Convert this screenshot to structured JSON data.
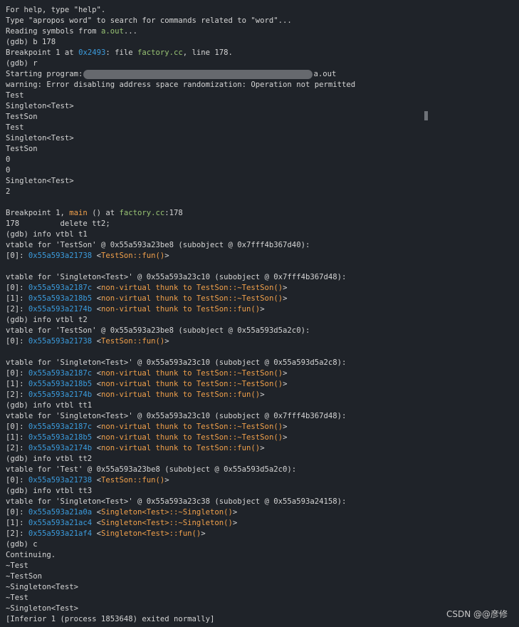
{
  "terminal": {
    "lines": [
      [
        {
          "t": "For help, type \"help\".",
          "s": "plain"
        }
      ],
      [
        {
          "t": "Type \"apropos word\" to search for commands related to \"word\"...",
          "s": "plain"
        }
      ],
      [
        {
          "t": "Reading symbols from ",
          "s": "plain"
        },
        {
          "t": "a.out",
          "s": "file"
        },
        {
          "t": "...",
          "s": "plain"
        }
      ],
      [
        {
          "t": "(gdb) b 178",
          "s": "plain"
        }
      ],
      [
        {
          "t": "Breakpoint 1 at ",
          "s": "plain"
        },
        {
          "t": "0x2493",
          "s": "addr"
        },
        {
          "t": ": file ",
          "s": "plain"
        },
        {
          "t": "factory.cc",
          "s": "file"
        },
        {
          "t": ", line 178.",
          "s": "plain"
        }
      ],
      [
        {
          "t": "(gdb) r",
          "s": "plain"
        }
      ],
      [
        {
          "t": "Starting program:",
          "s": "plain"
        },
        {
          "t": "",
          "s": "redacted"
        },
        {
          "t": "a.out",
          "s": "plain"
        }
      ],
      [
        {
          "t": "warning: Error disabling address space randomization: Operation not permitted",
          "s": "plain"
        }
      ],
      [
        {
          "t": "Test",
          "s": "plain"
        }
      ],
      [
        {
          "t": "Singleton<Test>",
          "s": "plain"
        }
      ],
      [
        {
          "t": "TestSon",
          "s": "plain"
        }
      ],
      [
        {
          "t": "Test",
          "s": "plain"
        }
      ],
      [
        {
          "t": "Singleton<Test>",
          "s": "plain"
        }
      ],
      [
        {
          "t": "TestSon",
          "s": "plain"
        }
      ],
      [
        {
          "t": "0",
          "s": "plain"
        }
      ],
      [
        {
          "t": "0",
          "s": "plain"
        }
      ],
      [
        {
          "t": "Singleton<Test>",
          "s": "plain"
        }
      ],
      [
        {
          "t": "2",
          "s": "plain"
        }
      ],
      [],
      [
        {
          "t": "Breakpoint 1, ",
          "s": "plain"
        },
        {
          "t": "main",
          "s": "func"
        },
        {
          "t": " () at ",
          "s": "plain"
        },
        {
          "t": "factory.cc",
          "s": "file"
        },
        {
          "t": ":178",
          "s": "plain"
        }
      ],
      [
        {
          "t": "178         delete tt2;",
          "s": "plain"
        }
      ],
      [
        {
          "t": "(gdb) info vtbl t1",
          "s": "plain"
        }
      ],
      [
        {
          "t": "vtable for 'TestSon' @ 0x55a593a23be8 (subobject @ 0x7fff4b367d40):",
          "s": "plain"
        }
      ],
      [
        {
          "t": "[0]: ",
          "s": "plain"
        },
        {
          "t": "0x55a593a21738",
          "s": "addr"
        },
        {
          "t": " <",
          "s": "plain"
        },
        {
          "t": "TestSon::fun()",
          "s": "func"
        },
        {
          "t": ">",
          "s": "plain"
        }
      ],
      [],
      [
        {
          "t": "vtable for 'Singleton<Test>' @ 0x55a593a23c10 (subobject @ 0x7fff4b367d48):",
          "s": "plain"
        }
      ],
      [
        {
          "t": "[0]: ",
          "s": "plain"
        },
        {
          "t": "0x55a593a2187c",
          "s": "addr"
        },
        {
          "t": " <",
          "s": "plain"
        },
        {
          "t": "non-virtual thunk to TestSon::~TestSon()",
          "s": "func"
        },
        {
          "t": ">",
          "s": "plain"
        }
      ],
      [
        {
          "t": "[1]: ",
          "s": "plain"
        },
        {
          "t": "0x55a593a218b5",
          "s": "addr"
        },
        {
          "t": " <",
          "s": "plain"
        },
        {
          "t": "non-virtual thunk to TestSon::~TestSon()",
          "s": "func"
        },
        {
          "t": ">",
          "s": "plain"
        }
      ],
      [
        {
          "t": "[2]: ",
          "s": "plain"
        },
        {
          "t": "0x55a593a2174b",
          "s": "addr"
        },
        {
          "t": " <",
          "s": "plain"
        },
        {
          "t": "non-virtual thunk to TestSon::fun()",
          "s": "func"
        },
        {
          "t": ">",
          "s": "plain"
        }
      ],
      [
        {
          "t": "(gdb) info vtbl t2",
          "s": "plain"
        }
      ],
      [
        {
          "t": "vtable for 'TestSon' @ 0x55a593a23be8 (subobject @ 0x55a593d5a2c0):",
          "s": "plain"
        }
      ],
      [
        {
          "t": "[0]: ",
          "s": "plain"
        },
        {
          "t": "0x55a593a21738",
          "s": "addr"
        },
        {
          "t": " <",
          "s": "plain"
        },
        {
          "t": "TestSon::fun()",
          "s": "func"
        },
        {
          "t": ">",
          "s": "plain"
        }
      ],
      [],
      [
        {
          "t": "vtable for 'Singleton<Test>' @ 0x55a593a23c10 (subobject @ 0x55a593d5a2c8):",
          "s": "plain"
        }
      ],
      [
        {
          "t": "[0]: ",
          "s": "plain"
        },
        {
          "t": "0x55a593a2187c",
          "s": "addr"
        },
        {
          "t": " <",
          "s": "plain"
        },
        {
          "t": "non-virtual thunk to TestSon::~TestSon()",
          "s": "func"
        },
        {
          "t": ">",
          "s": "plain"
        }
      ],
      [
        {
          "t": "[1]: ",
          "s": "plain"
        },
        {
          "t": "0x55a593a218b5",
          "s": "addr"
        },
        {
          "t": " <",
          "s": "plain"
        },
        {
          "t": "non-virtual thunk to TestSon::~TestSon()",
          "s": "func"
        },
        {
          "t": ">",
          "s": "plain"
        }
      ],
      [
        {
          "t": "[2]: ",
          "s": "plain"
        },
        {
          "t": "0x55a593a2174b",
          "s": "addr"
        },
        {
          "t": " <",
          "s": "plain"
        },
        {
          "t": "non-virtual thunk to TestSon::fun()",
          "s": "func"
        },
        {
          "t": ">",
          "s": "plain"
        }
      ],
      [
        {
          "t": "(gdb) info vtbl tt1",
          "s": "plain"
        }
      ],
      [
        {
          "t": "vtable for 'Singleton<Test>' @ 0x55a593a23c10 (subobject @ 0x7fff4b367d48):",
          "s": "plain"
        }
      ],
      [
        {
          "t": "[0]: ",
          "s": "plain"
        },
        {
          "t": "0x55a593a2187c",
          "s": "addr"
        },
        {
          "t": " <",
          "s": "plain"
        },
        {
          "t": "non-virtual thunk to TestSon::~TestSon()",
          "s": "func"
        },
        {
          "t": ">",
          "s": "plain"
        }
      ],
      [
        {
          "t": "[1]: ",
          "s": "plain"
        },
        {
          "t": "0x55a593a218b5",
          "s": "addr"
        },
        {
          "t": " <",
          "s": "plain"
        },
        {
          "t": "non-virtual thunk to TestSon::~TestSon()",
          "s": "func"
        },
        {
          "t": ">",
          "s": "plain"
        }
      ],
      [
        {
          "t": "[2]: ",
          "s": "plain"
        },
        {
          "t": "0x55a593a2174b",
          "s": "addr"
        },
        {
          "t": " <",
          "s": "plain"
        },
        {
          "t": "non-virtual thunk to TestSon::fun()",
          "s": "func"
        },
        {
          "t": ">",
          "s": "plain"
        }
      ],
      [
        {
          "t": "(gdb) info vtbl tt2",
          "s": "plain"
        }
      ],
      [
        {
          "t": "vtable for 'Test' @ 0x55a593a23be8 (subobject @ 0x55a593d5a2c0):",
          "s": "plain"
        }
      ],
      [
        {
          "t": "[0]: ",
          "s": "plain"
        },
        {
          "t": "0x55a593a21738",
          "s": "addr"
        },
        {
          "t": " <",
          "s": "plain"
        },
        {
          "t": "TestSon::fun()",
          "s": "func"
        },
        {
          "t": ">",
          "s": "plain"
        }
      ],
      [
        {
          "t": "(gdb) info vtbl tt3",
          "s": "plain"
        }
      ],
      [
        {
          "t": "vtable for 'Singleton<Test>' @ 0x55a593a23c38 (subobject @ 0x55a593a24158):",
          "s": "plain"
        }
      ],
      [
        {
          "t": "[0]: ",
          "s": "plain"
        },
        {
          "t": "0x55a593a21a0a",
          "s": "addr"
        },
        {
          "t": " <",
          "s": "plain"
        },
        {
          "t": "Singleton<Test>::~Singleton()",
          "s": "func"
        },
        {
          "t": ">",
          "s": "plain"
        }
      ],
      [
        {
          "t": "[1]: ",
          "s": "plain"
        },
        {
          "t": "0x55a593a21ac4",
          "s": "addr"
        },
        {
          "t": " <",
          "s": "plain"
        },
        {
          "t": "Singleton<Test>::~Singleton()",
          "s": "func"
        },
        {
          "t": ">",
          "s": "plain"
        }
      ],
      [
        {
          "t": "[2]: ",
          "s": "plain"
        },
        {
          "t": "0x55a593a21af4",
          "s": "addr"
        },
        {
          "t": " <",
          "s": "plain"
        },
        {
          "t": "Singleton<Test>::fun()",
          "s": "func"
        },
        {
          "t": ">",
          "s": "plain"
        }
      ],
      [
        {
          "t": "(gdb) c",
          "s": "plain"
        }
      ],
      [
        {
          "t": "Continuing.",
          "s": "plain"
        }
      ],
      [
        {
          "t": "~Test",
          "s": "plain"
        }
      ],
      [
        {
          "t": "~TestSon",
          "s": "plain"
        }
      ],
      [
        {
          "t": "~Singleton<Test>",
          "s": "plain"
        }
      ],
      [
        {
          "t": "~Test",
          "s": "plain"
        }
      ],
      [
        {
          "t": "~Singleton<Test>",
          "s": "plain"
        }
      ],
      [
        {
          "t": "[Inferior 1 (process 1853648) exited normally]",
          "s": "plain"
        }
      ]
    ]
  },
  "watermark": {
    "text": "CSDN @@彦修"
  },
  "colors": {
    "background": "#1f2329",
    "text": "#d4d4d4",
    "address": "#3b9bdc",
    "function": "#f0a04b",
    "file": "#98c373"
  }
}
